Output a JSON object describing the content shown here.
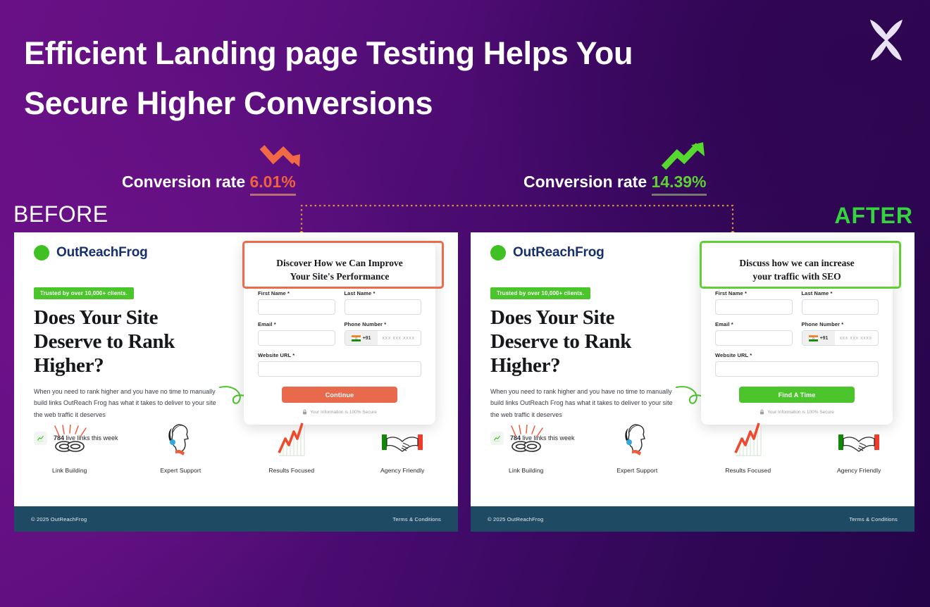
{
  "headline": {
    "line1": "Efficient Landing page Testing Helps You",
    "line2": "Secure Higher Conversions"
  },
  "logo": {
    "name": "x-logo",
    "color": "#e9e2f5"
  },
  "metrics": {
    "before": {
      "label": "Conversion rate",
      "value": "6.01%",
      "color": "#f0613f",
      "trend": "down-arrow-icon"
    },
    "after": {
      "label": "Conversion rate",
      "value": "14.39%",
      "color": "#5fcf35",
      "trend": "up-arrow-icon"
    }
  },
  "labels": {
    "before": "BEFORE",
    "after": "AFTER",
    "before_color": "#ffffff",
    "after_color": "#35d43f"
  },
  "landing": {
    "brand": "OutReachFrog",
    "pill": "Trusted by over 10,000+ clients.",
    "h1_line1": "Does Your Site",
    "h1_line2": "Deserve to Rank",
    "h1_line3": "Higher?",
    "sub": "When you need to rank higher and you have no time to manually build links OutReach Frog has what it takes to deliver to your site the web traffic it deserves",
    "livelinks_count": "784",
    "livelinks_text": " live links this week",
    "form": {
      "first_name": "First Name *",
      "last_name": "Last Name *",
      "email": "Email *",
      "phone": "Phone Number *",
      "website": "Website URL *",
      "country_code": "+91",
      "phone_placeholder": "xxx xxx xxxx",
      "secure": "Your Information is 100% Secure"
    },
    "features": [
      {
        "caption": "Link Building",
        "icon": "broken-chain-icon"
      },
      {
        "caption": "Expert Support",
        "icon": "headset-person-icon"
      },
      {
        "caption": "Results Focused",
        "icon": "growth-chart-icon"
      },
      {
        "caption": "Agency Friendly",
        "icon": "handshake-icon"
      }
    ],
    "footer": {
      "copyright": "© 2025 OutReachFrog",
      "terms": "Terms & Conditions"
    }
  },
  "variant_before": {
    "form_title_line1": "Discover How we Can Improve",
    "form_title_line2": "Your Site's Performance",
    "cta": "Continue",
    "accent": "#ef6a4a"
  },
  "variant_after": {
    "form_title_line1": "Discuss how we can increase",
    "form_title_line2": "your traffic with SEO",
    "cta": "Find A Time",
    "accent": "#5fcf35"
  }
}
